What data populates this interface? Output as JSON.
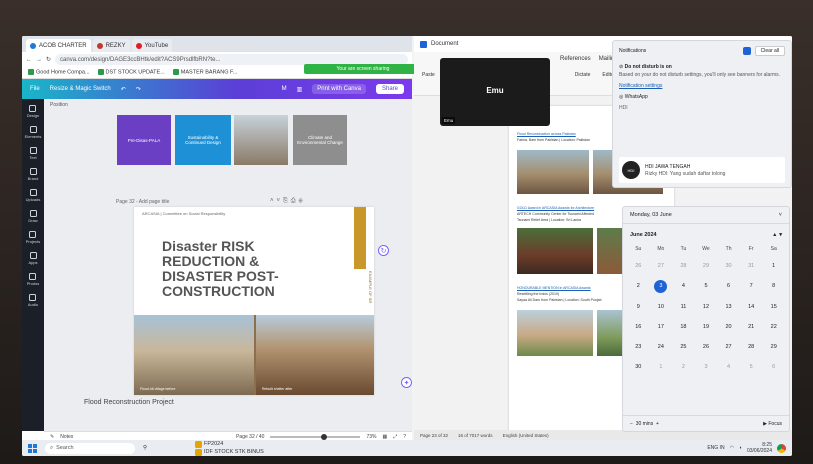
{
  "browser": {
    "tabs": [
      {
        "label": "ACOB CHARTER",
        "color": "#1e78d6"
      },
      {
        "label": "REZKY",
        "color": "#c0392b"
      },
      {
        "label": "YouTube",
        "color": "#e11d1d"
      }
    ],
    "url": "canva.com/design/DAGE3ccBHtk/edit?ACS9PrsdlfbRN?te...",
    "bookmarks": [
      "Good Home Compa...",
      "DST STOCK UPDATE...",
      "MASTER BARANG F..."
    ],
    "all_bookmarks": "All Bookmarks"
  },
  "canva": {
    "menu": [
      "File",
      "Resize & Magic Switch"
    ],
    "user_initial": "M",
    "print_label": "Print with Canva",
    "share_label": "Share",
    "sidebar": [
      "Design",
      "Elements",
      "Text",
      "Brand",
      "Uploads",
      "Draw",
      "Projects",
      "Apps",
      "Photos",
      "Audio"
    ],
    "position_label": "Position",
    "tiles": [
      {
        "text": "Pre-Disas-PALA",
        "color": "#6b3fc4"
      },
      {
        "text": "Sustainability & Continued Design",
        "color": "#1e90d6"
      },
      {
        "text": "",
        "color": "#9a8a78"
      },
      {
        "text": "Climate and Environmental Change",
        "color": "#8e8e8e"
      }
    ],
    "page_label": "Page 32 - Add page title",
    "slide_header": "ARCASIA   |   Committee on Social Responsibility",
    "slide_title": "Disaster RISK\nREDUCTION &\nDISASTER POST-\nCONSTRUCTION",
    "slide_vertical": "EXAMPLE OF SR",
    "photo_caption_left": "Flood-hit village before",
    "photo_caption_right": "Rebuilt shelter after",
    "caption_below": "Flood Reconstruction Project",
    "notes_label": "Notes",
    "page_counter": "Page 32 / 40",
    "zoom_level": "73%",
    "zoom_fraction": 0.6
  },
  "share_banner": "Your are screen sharing",
  "zoom_participant": {
    "name": "Emu",
    "tag": "Emu"
  },
  "word": {
    "title": "Document",
    "ribbon_tabs": [
      "References",
      "Mailin"
    ],
    "ribbon_tools": [
      "Paste",
      "Dictate",
      "Editor"
    ],
    "doc_lines": [
      "Flood Reconstruction across Pakistan",
      "Fatma, Bam from Pakistan | Location: Pakistan",
      "GOLD Award in ARCASIA Awards for Architecture",
      "ARTECH Community Center for Tsunami Affected",
      "Tsunami Relief Area | Location: Sri Lanka",
      "HONOURABLE MENTION in ARCASIA Awards",
      "Resettling the Indus (2019)",
      "Sayaa Ali Daru from Pakistan | Location: South Punjab"
    ],
    "status": [
      "Page 23 of 32",
      "16 of 7017 words",
      "English (United States)"
    ]
  },
  "notifications": {
    "title": "Notifications",
    "clear_all": "Clear all",
    "dnd_title": "Do not disturb is on",
    "dnd_desc": "Based on your do not disturb settings, you'll only see banners for alarms.",
    "settings_link": "Notification settings",
    "app_whatsapp": "WhatsApp",
    "app_hdi": "HDI",
    "card_title": "HDI JAWA TENGAH",
    "card_body": "Rizky HDI: Yang sudah daftar tolong",
    "card_logo": "HDI"
  },
  "calendar": {
    "date_header": "Monday, 03 June",
    "month_label": "June 2024",
    "weekdays": [
      "Su",
      "Mo",
      "Tu",
      "We",
      "Th",
      "Fr",
      "Sa"
    ],
    "days": [
      {
        "d": "26",
        "m": true
      },
      {
        "d": "27",
        "m": true
      },
      {
        "d": "28",
        "m": true
      },
      {
        "d": "29",
        "m": true
      },
      {
        "d": "30",
        "m": true
      },
      {
        "d": "31",
        "m": true
      },
      {
        "d": "1"
      },
      {
        "d": "2"
      },
      {
        "d": "3",
        "t": true
      },
      {
        "d": "4"
      },
      {
        "d": "5"
      },
      {
        "d": "6"
      },
      {
        "d": "7"
      },
      {
        "d": "8"
      },
      {
        "d": "9"
      },
      {
        "d": "10"
      },
      {
        "d": "11"
      },
      {
        "d": "12"
      },
      {
        "d": "13"
      },
      {
        "d": "14"
      },
      {
        "d": "15"
      },
      {
        "d": "16"
      },
      {
        "d": "17"
      },
      {
        "d": "18"
      },
      {
        "d": "19"
      },
      {
        "d": "20"
      },
      {
        "d": "21"
      },
      {
        "d": "22"
      },
      {
        "d": "23"
      },
      {
        "d": "24"
      },
      {
        "d": "25"
      },
      {
        "d": "26"
      },
      {
        "d": "27"
      },
      {
        "d": "28"
      },
      {
        "d": "29"
      },
      {
        "d": "30"
      },
      {
        "d": "1",
        "m": true
      },
      {
        "d": "2",
        "m": true
      },
      {
        "d": "3",
        "m": true
      },
      {
        "d": "4",
        "m": true
      },
      {
        "d": "5",
        "m": true
      },
      {
        "d": "6",
        "m": true
      }
    ],
    "focus_minutes": "30 mins",
    "focus_label": "Focus"
  },
  "taskbar": {
    "search_placeholder": "Search",
    "items": [
      {
        "label": "FP2024",
        "color": "#e6a400"
      },
      {
        "label": "IDF STOCK STK BINUS",
        "color": "#e6a400"
      }
    ],
    "time": "8:25",
    "date": "03/06/2024",
    "lang": "ENG IN"
  },
  "colors": {
    "accent": "#1e63d6",
    "canva_purple": "#7c3aed",
    "share_green": "#2fb344"
  }
}
